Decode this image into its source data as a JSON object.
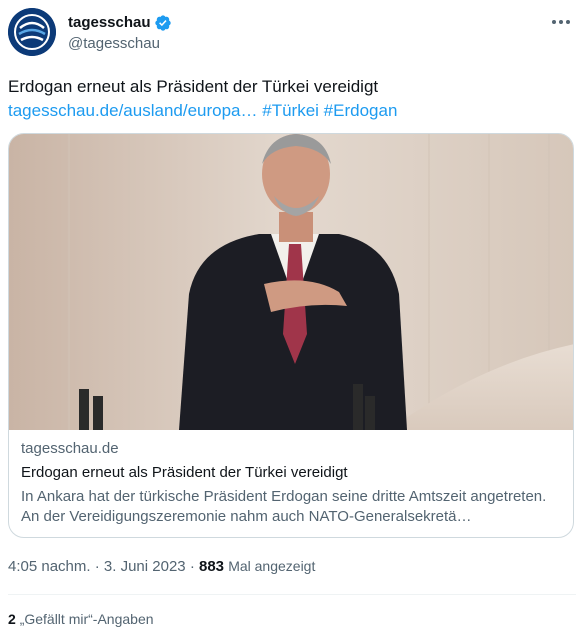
{
  "account": {
    "display_name": "tagesschau",
    "handle": "@tagesschau",
    "avatar_icon": "tagesschau-logo-icon",
    "verified_icon": "verified-badge-icon",
    "brand_color": "#0c3a78",
    "verified_color": "#1d9bf0"
  },
  "tweet": {
    "text": "Erdogan erneut als Präsident der Türkei vereidigt",
    "link": "tagesschau.de/ausland/europa…",
    "hashtags": [
      "#Türkei",
      "#Erdogan"
    ],
    "link_color": "#1d9bf0"
  },
  "card": {
    "domain": "tagesschau.de",
    "title": "Erdogan erneut als Präsident der Türkei vereidigt",
    "description": "In Ankara hat der türkische Präsident Erdogan seine dritte Amtszeit angetreten. An der Vereidigungszeremonie nahm auch NATO-Generalsekretä…"
  },
  "meta": {
    "time": "4:05 nachm.",
    "separator": "·",
    "date": "3. Juni 2023",
    "views_count": "883",
    "views_label": "Mal angezeigt"
  },
  "engagement": {
    "likes_count": "2",
    "likes_label": "„Gefällt mir“-Angaben"
  },
  "more_icon": "more-options-icon"
}
